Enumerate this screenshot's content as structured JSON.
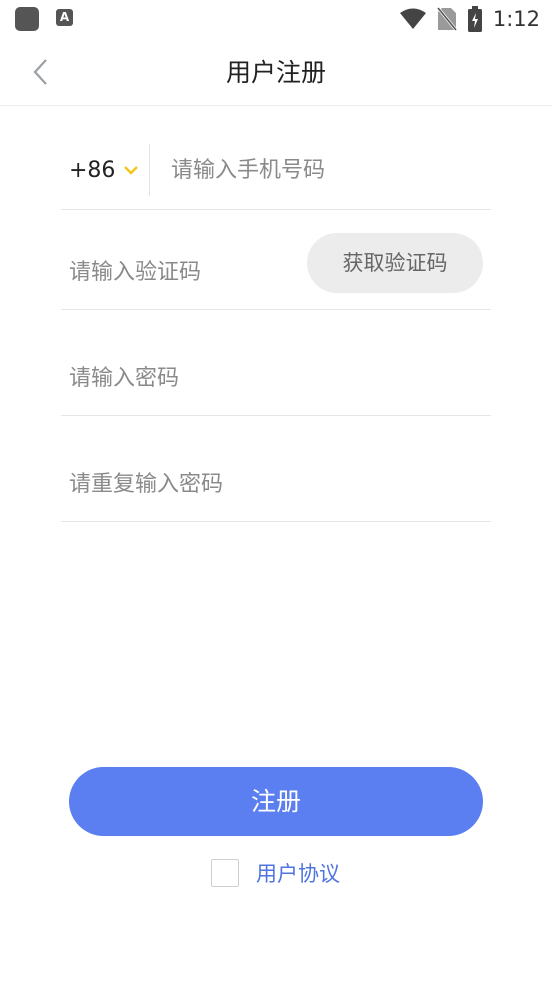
{
  "status_bar": {
    "time": "1:12",
    "app_badge_letter": "A"
  },
  "nav": {
    "title": "用户注册"
  },
  "form": {
    "country_code": "+86",
    "phone_placeholder": "请输入手机号码",
    "code_placeholder": "请输入验证码",
    "get_code_label": "获取验证码",
    "password_placeholder": "请输入密码",
    "confirm_password_placeholder": "请重复输入密码"
  },
  "register_label": "注册",
  "agreement_label": "用户协议",
  "colors": {
    "primary": "#5b7ff0",
    "link": "#4f74df",
    "chevron": "#f5c518"
  },
  "icons": {
    "back": "chevron-left-icon",
    "country_dropdown": "chevron-down-icon"
  }
}
